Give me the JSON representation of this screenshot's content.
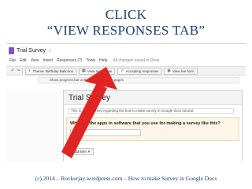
{
  "slide": {
    "title_line1": "CLICK",
    "title_line2": "“VIEW RESPONSES TAB”",
    "footer": "(c) 2014 – Rockerjay.wordpress.com – How to make Survey in Google Docs"
  },
  "app": {
    "doc_title": "Trial Survey",
    "star_icon": "star-icon",
    "menu": [
      "File",
      "Edit",
      "View",
      "Insert",
      "Responses (?)",
      "Tools",
      "Help"
    ],
    "saved_status": "All changes saved in Drive"
  },
  "toolbar": {
    "theme_label": "Theme: Birthday Balloons",
    "view_responses_label": "View responses",
    "accepting_label": "Accepting responses",
    "view_form_label": "View live form"
  },
  "notice": {
    "text": "Show progress bar at the bottom of form pages"
  },
  "form": {
    "title": "Trial Survey",
    "description": "This is a trial survey regarding the how to make survey in Google docs tutorial.",
    "question": "What are the apps in software that you use for making a survey like this?",
    "add_item_label": "Add item"
  },
  "colors": {
    "title_text": "#1f3f6e",
    "arrow": "#e02424"
  }
}
